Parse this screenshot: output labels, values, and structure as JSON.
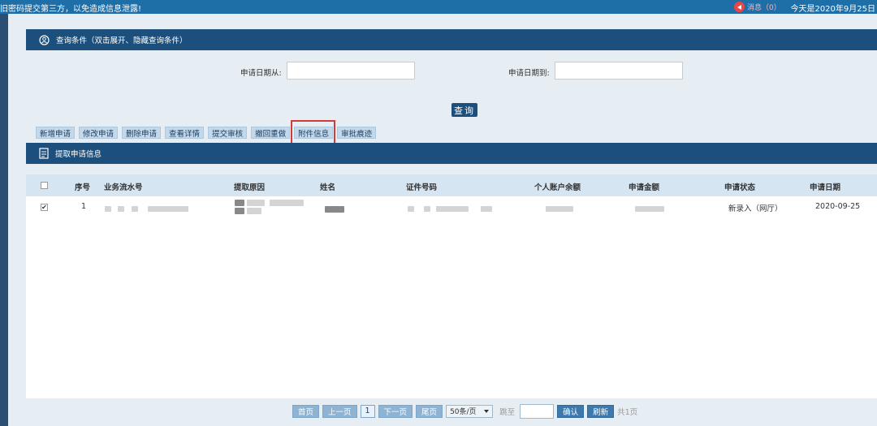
{
  "topbar": {
    "notice": "旧密码提交第三方，以免造成信息泄露!",
    "message": "消息（0）",
    "today": "今天是2020年9月25日"
  },
  "query": {
    "title": "查询条件（双击展开、隐藏查询条件）",
    "date_from_label": "申请日期从:",
    "date_to_label": "申请日期到:",
    "date_from_value": "",
    "date_to_value": "",
    "query_button": "查询"
  },
  "toolbar": {
    "buttons": [
      "新增申请",
      "修改申请",
      "删除申请",
      "查看详情",
      "提交审核",
      "撤回重做",
      "附件信息",
      "审批痕迹"
    ]
  },
  "list": {
    "title": "提取申请信息",
    "columns": [
      "序号",
      "业务流水号",
      "提取原因",
      "姓名",
      "证件号码",
      "个人账户余额",
      "申请金额",
      "申请状态",
      "申请日期"
    ],
    "rows": [
      {
        "checked": true,
        "index": "1",
        "status": "新录入（网厅）",
        "date": "2020-09-25"
      }
    ]
  },
  "pager": {
    "first": "首页",
    "prev": "上一页",
    "page": "1",
    "next": "下一页",
    "last": "尾页",
    "page_size": "50条/页",
    "jump_label": "跳至",
    "confirm": "确认",
    "refresh": "刷新",
    "total": "共1页"
  },
  "colors": {
    "header_bg": "#1d4f7c",
    "topbar_bg": "#1e6ea8",
    "highlight": "#d23b3b"
  }
}
